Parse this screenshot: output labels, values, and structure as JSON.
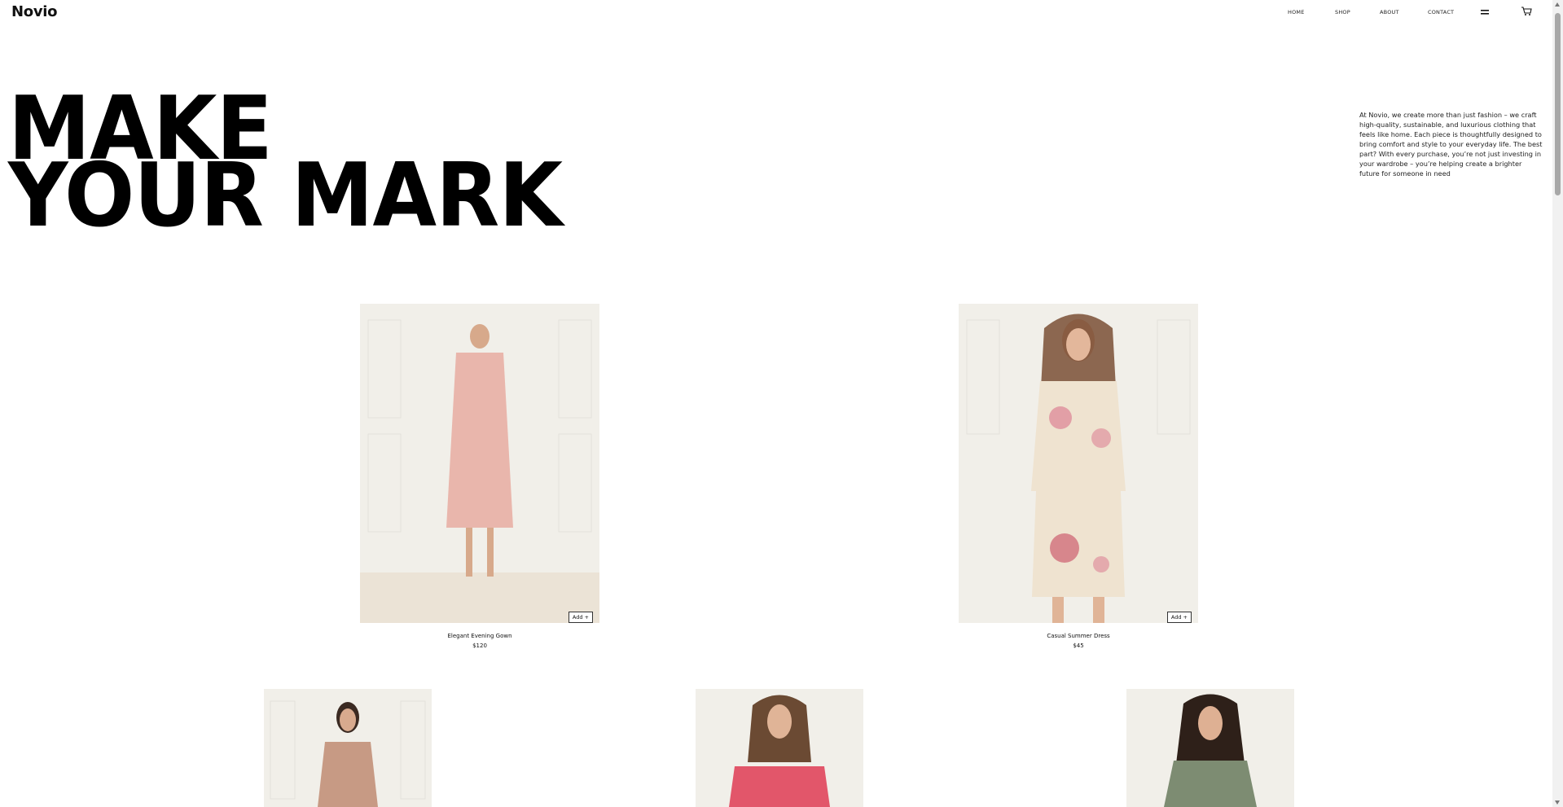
{
  "header": {
    "brand": "Novio",
    "nav": [
      "HOME",
      "SHOP",
      "ABOUT",
      "CONTACT"
    ],
    "menu_icon": "hamburger-icon",
    "cart_icon": "cart-icon"
  },
  "hero": {
    "line1": "MAKE",
    "line2": "YOUR MARK",
    "blurb": "At Novio, we create more than just fashion – we craft high-quality, sustainable, and luxurious clothing that feels like home. Each piece is thoughtfully designed to bring comfort and style to your everyday life. The best part? With every purchase, you’re not just investing in your wardrobe – you’re helping create a brighter future for someone in need"
  },
  "products": [
    {
      "name": "Elegant Evening Gown",
      "price": "$120",
      "add_label": "Add +",
      "color": "#e9b6ac"
    },
    {
      "name": "Casual Summer Dress",
      "price": "$45",
      "add_label": "Add +",
      "color": "#efe3d0"
    },
    {
      "color": "#c79a84"
    },
    {
      "color": "#e2566a"
    },
    {
      "color": "#7d8c72"
    }
  ],
  "colors": {
    "text": "#111111",
    "background": "#ffffff"
  }
}
